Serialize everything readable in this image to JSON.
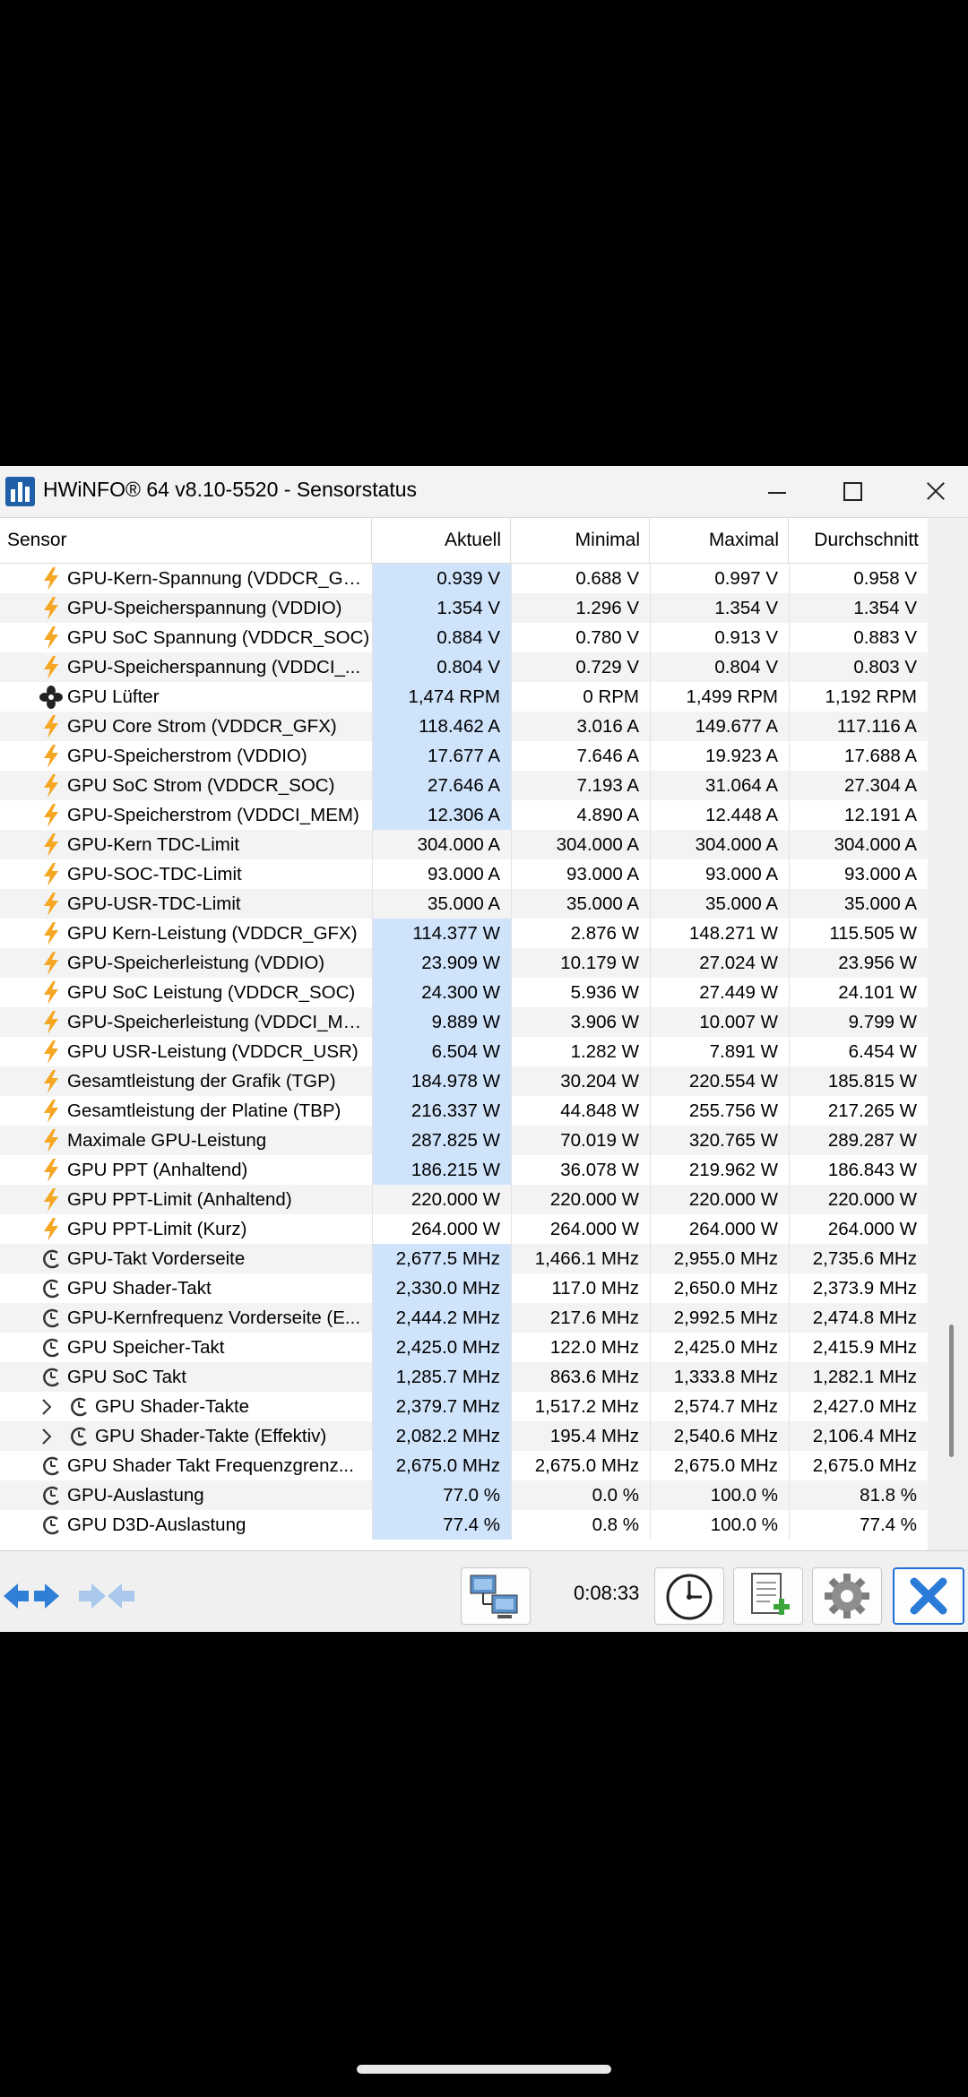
{
  "window": {
    "title": "HWiNFO® 64 v8.10-5520 - Sensorstatus"
  },
  "columns": {
    "sensor": "Sensor",
    "current": "Aktuell",
    "min": "Minimal",
    "max": "Maximal",
    "avg": "Durchschnitt"
  },
  "rows": [
    {
      "icon": "bolt",
      "name": "GPU-Kern-Spannung (VDDCR_GFX)",
      "cur": "0.939 V",
      "min": "0.688 V",
      "max": "0.997 V",
      "avg": "0.958 V",
      "hl": true
    },
    {
      "icon": "bolt",
      "name": "GPU-Speicherspannung (VDDIO)",
      "cur": "1.354 V",
      "min": "1.296 V",
      "max": "1.354 V",
      "avg": "1.354 V",
      "hl": true
    },
    {
      "icon": "bolt",
      "name": "GPU SoC Spannung (VDDCR_SOC)",
      "cur": "0.884 V",
      "min": "0.780 V",
      "max": "0.913 V",
      "avg": "0.883 V",
      "hl": true
    },
    {
      "icon": "bolt",
      "name": "GPU-Speicherspannung (VDDCI_...",
      "cur": "0.804 V",
      "min": "0.729 V",
      "max": "0.804 V",
      "avg": "0.803 V",
      "hl": true
    },
    {
      "icon": "fan",
      "name": "GPU Lüfter",
      "cur": "1,474 RPM",
      "min": "0 RPM",
      "max": "1,499 RPM",
      "avg": "1,192 RPM",
      "hl": true
    },
    {
      "icon": "bolt",
      "name": "GPU Core Strom (VDDCR_GFX)",
      "cur": "118.462 A",
      "min": "3.016 A",
      "max": "149.677 A",
      "avg": "117.116 A",
      "hl": true
    },
    {
      "icon": "bolt",
      "name": "GPU-Speicherstrom (VDDIO)",
      "cur": "17.677 A",
      "min": "7.646 A",
      "max": "19.923 A",
      "avg": "17.688 A",
      "hl": true
    },
    {
      "icon": "bolt",
      "name": "GPU SoC Strom (VDDCR_SOC)",
      "cur": "27.646 A",
      "min": "7.193 A",
      "max": "31.064 A",
      "avg": "27.304 A",
      "hl": true
    },
    {
      "icon": "bolt",
      "name": "GPU-Speicherstrom (VDDCI_MEM)",
      "cur": "12.306 A",
      "min": "4.890 A",
      "max": "12.448 A",
      "avg": "12.191 A",
      "hl": true
    },
    {
      "icon": "bolt",
      "name": "GPU-Kern TDC-Limit",
      "cur": "304.000 A",
      "min": "304.000 A",
      "max": "304.000 A",
      "avg": "304.000 A",
      "hl": false
    },
    {
      "icon": "bolt",
      "name": "GPU-SOC-TDC-Limit",
      "cur": "93.000 A",
      "min": "93.000 A",
      "max": "93.000 A",
      "avg": "93.000 A",
      "hl": false
    },
    {
      "icon": "bolt",
      "name": "GPU-USR-TDC-Limit",
      "cur": "35.000 A",
      "min": "35.000 A",
      "max": "35.000 A",
      "avg": "35.000 A",
      "hl": false
    },
    {
      "icon": "bolt",
      "name": "GPU Kern-Leistung (VDDCR_GFX)",
      "cur": "114.377 W",
      "min": "2.876 W",
      "max": "148.271 W",
      "avg": "115.505 W",
      "hl": true
    },
    {
      "icon": "bolt",
      "name": "GPU-Speicherleistung (VDDIO)",
      "cur": "23.909 W",
      "min": "10.179 W",
      "max": "27.024 W",
      "avg": "23.956 W",
      "hl": true
    },
    {
      "icon": "bolt",
      "name": "GPU SoC Leistung (VDDCR_SOC)",
      "cur": "24.300 W",
      "min": "5.936 W",
      "max": "27.449 W",
      "avg": "24.101 W",
      "hl": true
    },
    {
      "icon": "bolt",
      "name": "GPU-Speicherleistung (VDDCI_MEM)",
      "cur": "9.889 W",
      "min": "3.906 W",
      "max": "10.007 W",
      "avg": "9.799 W",
      "hl": true
    },
    {
      "icon": "bolt",
      "name": "GPU USR-Leistung (VDDCR_USR)",
      "cur": "6.504 W",
      "min": "1.282 W",
      "max": "7.891 W",
      "avg": "6.454 W",
      "hl": true
    },
    {
      "icon": "bolt",
      "name": "Gesamtleistung der Grafik (TGP)",
      "cur": "184.978 W",
      "min": "30.204 W",
      "max": "220.554 W",
      "avg": "185.815 W",
      "hl": true
    },
    {
      "icon": "bolt",
      "name": "Gesamtleistung der Platine (TBP)",
      "cur": "216.337 W",
      "min": "44.848 W",
      "max": "255.756 W",
      "avg": "217.265 W",
      "hl": true
    },
    {
      "icon": "bolt",
      "name": "Maximale GPU-Leistung",
      "cur": "287.825 W",
      "min": "70.019 W",
      "max": "320.765 W",
      "avg": "289.287 W",
      "hl": true
    },
    {
      "icon": "bolt",
      "name": "GPU PPT (Anhaltend)",
      "cur": "186.215 W",
      "min": "36.078 W",
      "max": "219.962 W",
      "avg": "186.843 W",
      "hl": true
    },
    {
      "icon": "bolt",
      "name": "GPU PPT-Limit (Anhaltend)",
      "cur": "220.000 W",
      "min": "220.000 W",
      "max": "220.000 W",
      "avg": "220.000 W",
      "hl": false
    },
    {
      "icon": "bolt",
      "name": "GPU PPT-Limit (Kurz)",
      "cur": "264.000 W",
      "min": "264.000 W",
      "max": "264.000 W",
      "avg": "264.000 W",
      "hl": false
    },
    {
      "icon": "clock",
      "name": "GPU-Takt Vorderseite",
      "cur": "2,677.5 MHz",
      "min": "1,466.1 MHz",
      "max": "2,955.0 MHz",
      "avg": "2,735.6 MHz",
      "hl": true
    },
    {
      "icon": "clock",
      "name": "GPU Shader-Takt",
      "cur": "2,330.0 MHz",
      "min": "117.0 MHz",
      "max": "2,650.0 MHz",
      "avg": "2,373.9 MHz",
      "hl": true
    },
    {
      "icon": "clock",
      "name": "GPU-Kernfrequenz Vorderseite (E...",
      "cur": "2,444.2 MHz",
      "min": "217.6 MHz",
      "max": "2,992.5 MHz",
      "avg": "2,474.8 MHz",
      "hl": true
    },
    {
      "icon": "clock",
      "name": "GPU Speicher-Takt",
      "cur": "2,425.0 MHz",
      "min": "122.0 MHz",
      "max": "2,425.0 MHz",
      "avg": "2,415.9 MHz",
      "hl": true
    },
    {
      "icon": "clock",
      "name": "GPU SoC Takt",
      "cur": "1,285.7 MHz",
      "min": "863.6 MHz",
      "max": "1,333.8 MHz",
      "avg": "1,282.1 MHz",
      "hl": true
    },
    {
      "icon": "clock",
      "name": "GPU Shader-Takte",
      "cur": "2,379.7 MHz",
      "min": "1,517.2 MHz",
      "max": "2,574.7 MHz",
      "avg": "2,427.0 MHz",
      "hl": true,
      "child": true
    },
    {
      "icon": "clock",
      "name": "GPU Shader-Takte (Effektiv)",
      "cur": "2,082.2 MHz",
      "min": "195.4 MHz",
      "max": "2,540.6 MHz",
      "avg": "2,106.4 MHz",
      "hl": true,
      "child": true
    },
    {
      "icon": "clock",
      "name": "GPU Shader Takt Frequenzgrenz...",
      "cur": "2,675.0 MHz",
      "min": "2,675.0 MHz",
      "max": "2,675.0 MHz",
      "avg": "2,675.0 MHz",
      "hl": true
    },
    {
      "icon": "clock",
      "name": "GPU-Auslastung",
      "cur": "77.0 %",
      "min": "0.0 %",
      "max": "100.0 %",
      "avg": "81.8 %",
      "hl": true
    },
    {
      "icon": "clock",
      "name": "GPU D3D-Auslastung",
      "cur": "77.4 %",
      "min": "0.8 %",
      "max": "100.0 %",
      "avg": "77.4 %",
      "hl": true
    }
  ],
  "toolbar": {
    "elapsed": "0:08:33"
  },
  "colors": {
    "bolt": "#f5a623",
    "highlight": "#cfe3fb",
    "accent": "#1f6fd6"
  }
}
